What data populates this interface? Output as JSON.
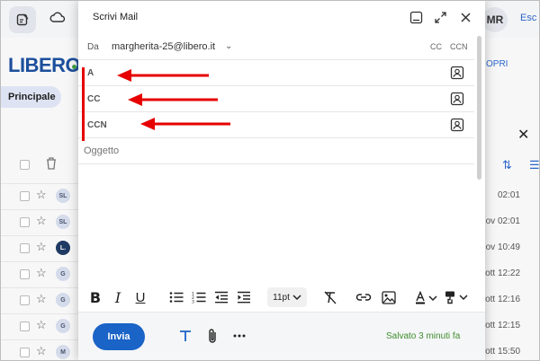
{
  "background": {
    "profile_initials": "MR",
    "logout_label": "Esc",
    "logo_text": "LIBERO",
    "primary_tab": "Principale",
    "apri_label": "OPRI",
    "rows": [
      {
        "initials": "SL",
        "time": "02:01",
        "dark": false
      },
      {
        "initials": "SL",
        "time": "ov 02:01",
        "dark": false
      },
      {
        "initials": "L.",
        "time": "ov 10:49",
        "dark": true
      },
      {
        "initials": "G",
        "time": "ott 12:22",
        "dark": false
      },
      {
        "initials": "G",
        "time": "ott 12:16",
        "dark": false
      },
      {
        "initials": "G",
        "time": "ott 12:15",
        "dark": false
      },
      {
        "initials": "M",
        "time": "ott 15:50",
        "dark": false
      }
    ]
  },
  "compose": {
    "title": "Scrivi Mail",
    "from_label": "Da",
    "from_value": "margherita-25@libero.it",
    "cc_link": "CC",
    "ccn_link": "CCN",
    "to_label": "A",
    "cc_label": "CC",
    "bcc_label": "CCN",
    "subject_placeholder": "Oggetto",
    "font_size": "11pt",
    "send_label": "Invia",
    "saved_status": "Salvato 3 minuti fa"
  },
  "colors": {
    "accent": "#1a63c7",
    "annotation": "#e60000",
    "saved": "#3f8d2e"
  }
}
